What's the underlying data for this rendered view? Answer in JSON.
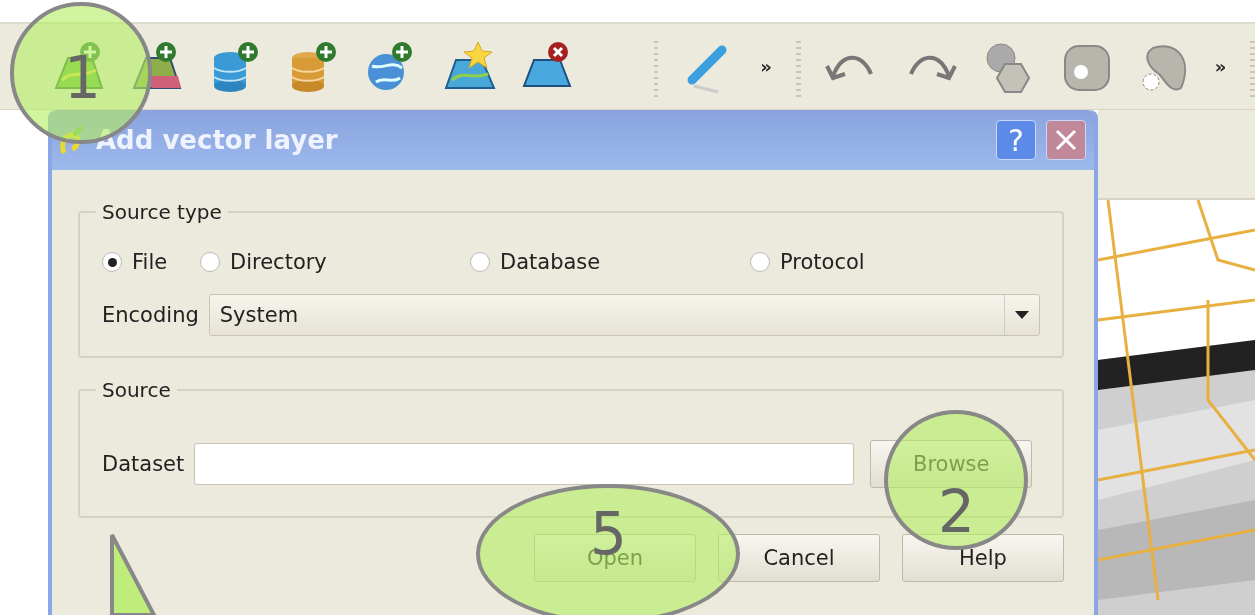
{
  "toolbar": {
    "overflow_buttons": [
      "»",
      "»"
    ]
  },
  "dialog": {
    "title": "Add vector layer",
    "help_button": "?",
    "source_type": {
      "title": "Source type",
      "options": [
        {
          "label": "File",
          "selected": true
        },
        {
          "label": "Directory",
          "selected": false
        },
        {
          "label": "Database",
          "selected": false
        },
        {
          "label": "Protocol",
          "selected": false
        }
      ],
      "encoding": {
        "label": "Encoding",
        "value": "System"
      }
    },
    "source": {
      "title": "Source",
      "dataset": {
        "label": "Dataset"
      },
      "browse_button": "Browse"
    },
    "buttons": [
      "Open",
      "Cancel",
      "Help"
    ]
  },
  "callouts": [
    {
      "kind": "circle",
      "number": "1"
    },
    {
      "kind": "circle",
      "number": "2"
    },
    {
      "kind": "ellipse",
      "number": "5"
    },
    {
      "kind": "pointer"
    }
  ]
}
